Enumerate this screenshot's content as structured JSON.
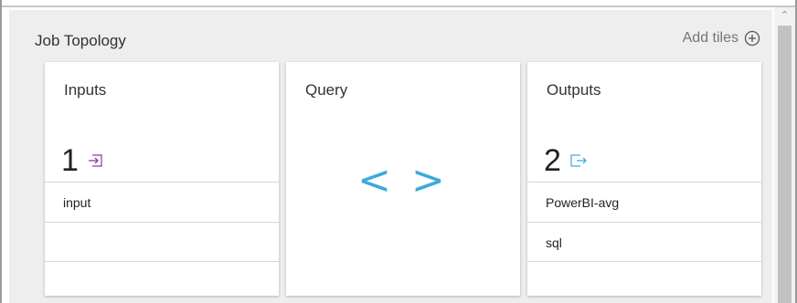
{
  "section": {
    "title": "Job Topology",
    "add_tiles_label": "Add tiles",
    "add_icon": "plus-circle-icon"
  },
  "tiles": {
    "inputs": {
      "title": "Inputs",
      "count": "1",
      "icon": "input-icon",
      "items": [
        "input"
      ]
    },
    "query": {
      "title": "Query",
      "glyph": "< >"
    },
    "outputs": {
      "title": "Outputs",
      "count": "2",
      "icon": "output-icon",
      "items": [
        "PowerBI-avg",
        "sql"
      ]
    }
  },
  "colors": {
    "accent": "#3eaad9",
    "input_icon": "#8a3aa5",
    "output_icon": "#3eaad9",
    "panel_bg": "#eeeeee"
  }
}
